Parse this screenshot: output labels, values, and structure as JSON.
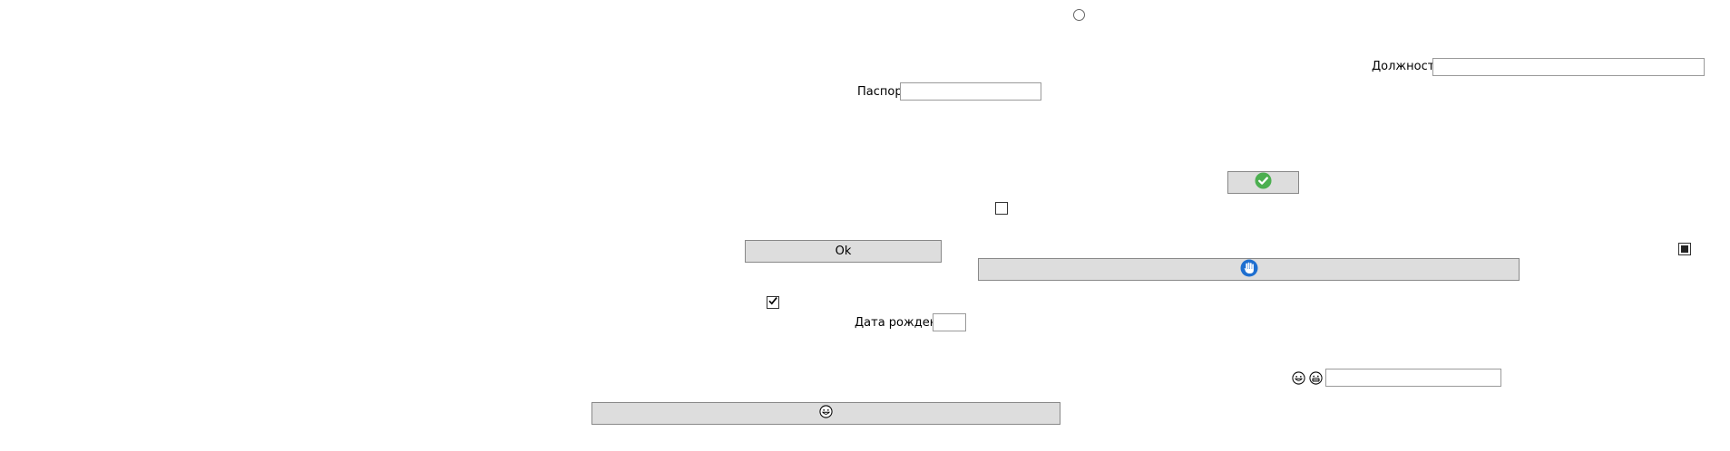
{
  "form": {
    "position_label": "Должность",
    "position_value": "",
    "passport_label": "Паспорт",
    "passport_value": "",
    "birthdate_label": "Дата рождения",
    "birthdate_value": "",
    "emoji_field_value": "",
    "ok_button_label": "Ok"
  },
  "controls": {
    "radio_checked": false,
    "checkbox_unchecked": false,
    "checkbox_checked": true,
    "checkbox_indeterminate": "indeterminate"
  },
  "icons": {
    "confirm_button_icon": "green-check-circle-icon",
    "hand_button_icon": "blue-hand-icon",
    "emoji_button_icon": "smiley-icon",
    "emoji_label_icons": [
      "smiley-icon",
      "grinning-face-icon"
    ]
  },
  "colors": {
    "button_bg": "#dddddd",
    "check_green": "#4caf50",
    "hand_blue": "#1e6fd0"
  }
}
